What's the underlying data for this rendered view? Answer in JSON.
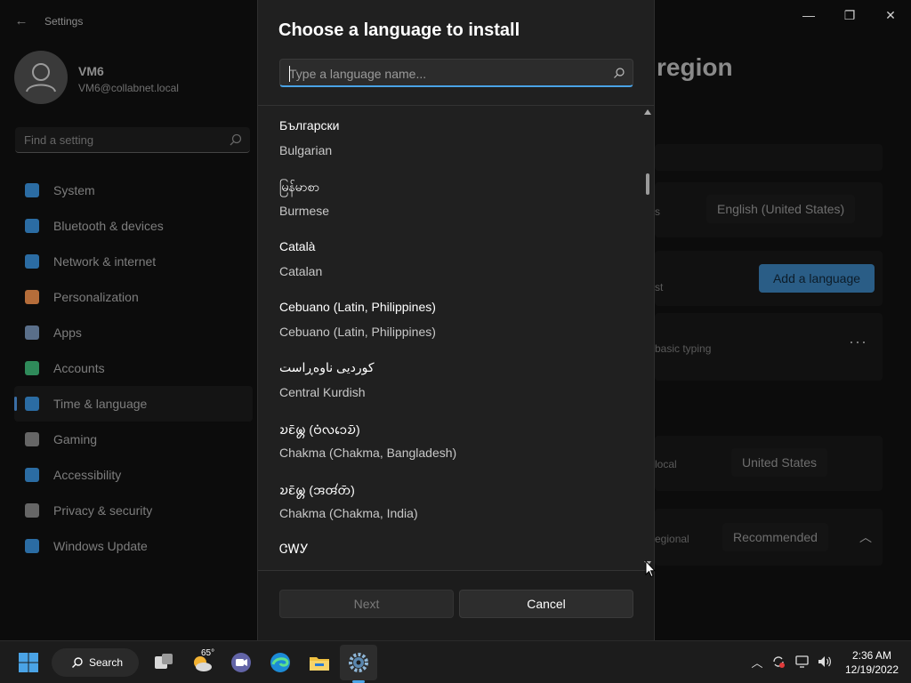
{
  "window": {
    "app_title": "Settings",
    "back_glyph": "←",
    "minimize_glyph": "—",
    "maximize_glyph": "❐",
    "close_glyph": "✕"
  },
  "user": {
    "name": "VM6",
    "email": "VM6@collabnet.local"
  },
  "find_setting": {
    "placeholder": "Find a setting"
  },
  "sidebar": {
    "items": [
      {
        "label": "System",
        "icon": "system-icon",
        "color": "#2b6ca3"
      },
      {
        "label": "Bluetooth & devices",
        "icon": "bluetooth-icon",
        "color": "#2b6ca3"
      },
      {
        "label": "Network & internet",
        "icon": "wifi-icon",
        "color": "#2b6ca3"
      },
      {
        "label": "Personalization",
        "icon": "brush-icon",
        "color": "#b56d3a"
      },
      {
        "label": "Apps",
        "icon": "apps-icon",
        "color": "#5a6f8a"
      },
      {
        "label": "Accounts",
        "icon": "accounts-icon",
        "color": "#2f8a5a"
      },
      {
        "label": "Time & language",
        "icon": "globe-clock-icon",
        "color": "#2b6ca3"
      },
      {
        "label": "Gaming",
        "icon": "gamepad-icon",
        "color": "#666666"
      },
      {
        "label": "Accessibility",
        "icon": "accessibility-icon",
        "color": "#2b6ca3"
      },
      {
        "label": "Privacy & security",
        "icon": "shield-icon",
        "color": "#666666"
      },
      {
        "label": "Windows Update",
        "icon": "update-icon",
        "color": "#2b6ca3"
      }
    ],
    "active_index": 6
  },
  "background_page": {
    "title_fragment": "region",
    "display_language_value": "English (United States)",
    "display_language_fragment": "s",
    "preferred_fragment": "st",
    "add_language_label": "Add a language",
    "language_row_fragment": "basic typing",
    "more_glyph": "···",
    "country_fragment": "local",
    "country_value": "United States",
    "regional_fragment": "egional",
    "regional_value": "Recommended",
    "chevron_up_glyph": "︿"
  },
  "dialog": {
    "title": "Choose a language to install",
    "search_placeholder": "Type a language name...",
    "languages": [
      {
        "native": "Български",
        "english": "Bulgarian"
      },
      {
        "native": "မြန်မာစာ",
        "english": "Burmese"
      },
      {
        "native": "Català",
        "english": "Catalan"
      },
      {
        "native": "Cebuano (Latin, Philippines)",
        "english": "Cebuano (Latin, Philippines)"
      },
      {
        "native": "کوردیی ناوەڕاست",
        "english": "Central Kurdish"
      },
      {
        "native": "𑄌𑄋𑄴𑄟𑄳𑄦 (𑄝𑄁𑄣𑄘𑄬𑄌𑄴)",
        "english": "Chakma (Chakma, Bangladesh)"
      },
      {
        "native": "𑄌𑄋𑄴𑄟𑄳𑄦 (𑄞𑄢𑄧𑄖𑄴)",
        "english": "Chakma (Chakma, India)"
      },
      {
        "native": "ᏣᎳᎩ",
        "english": ""
      }
    ],
    "next_label": "Next",
    "cancel_label": "Cancel"
  },
  "taskbar": {
    "search_label": "Search",
    "weather_temp": "65°",
    "clock_time": "2:36 AM",
    "clock_date": "12/19/2022",
    "accent": "#4aa3e6"
  }
}
